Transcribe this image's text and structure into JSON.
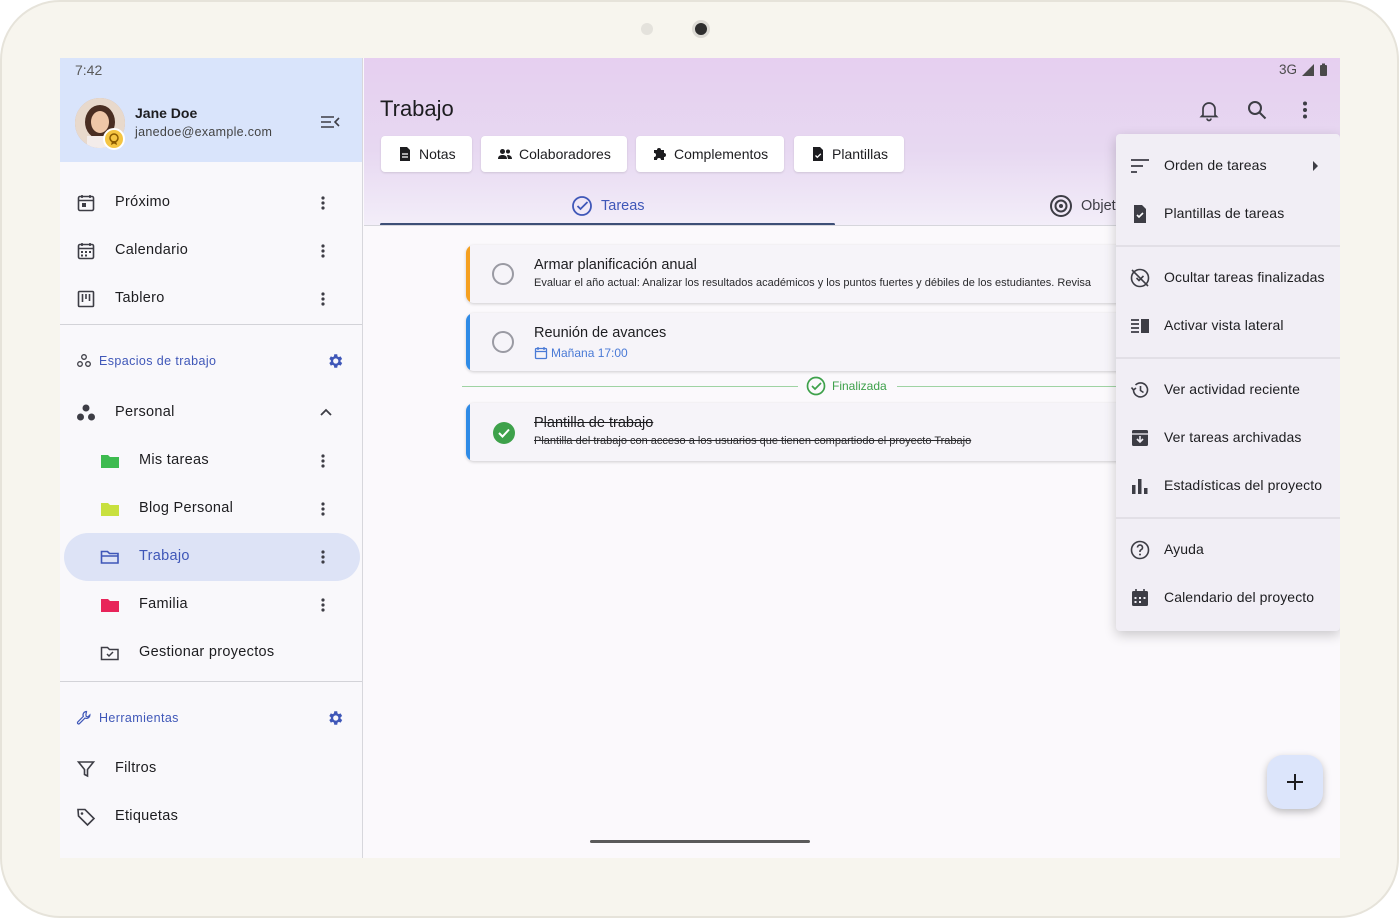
{
  "status": {
    "time": "7:42",
    "network": "3G"
  },
  "user": {
    "name": "Jane Doe",
    "email": "janedoe@example.com"
  },
  "nav": {
    "main_items": [
      {
        "label": "Próximo",
        "icon": "calendar-today-icon"
      },
      {
        "label": "Calendario",
        "icon": "calendar-month-icon"
      },
      {
        "label": "Tablero",
        "icon": "board-icon"
      }
    ],
    "workspaces_header": "Espacios de trabajo",
    "workspace": {
      "label": "Personal"
    },
    "projects": [
      {
        "label": "Mis tareas",
        "color": "#3dbb4f"
      },
      {
        "label": "Blog Personal",
        "color": "#c8e03e"
      },
      {
        "label": "Trabajo",
        "color": "#3f57b8"
      },
      {
        "label": "Familia",
        "color": "#e8245a"
      },
      {
        "label": "Gestionar proyectos"
      }
    ],
    "tools_header": "Herramientas",
    "tools": [
      {
        "label": "Filtros",
        "icon": "filter-icon"
      },
      {
        "label": "Etiquetas",
        "icon": "tag-icon"
      }
    ]
  },
  "main": {
    "title": "Trabajo",
    "chips": [
      {
        "label": "Notas",
        "icon": "note-icon"
      },
      {
        "label": "Colaboradores",
        "icon": "people-icon"
      },
      {
        "label": "Complementos",
        "icon": "puzzle-icon"
      },
      {
        "label": "Plantillas",
        "icon": "template-icon"
      }
    ],
    "tabs": [
      {
        "label": "Tareas",
        "active": true
      },
      {
        "label": "Objet"
      }
    ],
    "tasks": [
      {
        "title": "Armar planificación anual",
        "description": "Evaluar el año actual: Analizar los resultados académicos y los puntos fuertes y débiles de los estudiantes. Revisa",
        "color": "#f5a020",
        "done": false
      },
      {
        "title": "Reunión de avances",
        "due": "Mañana 17:00",
        "color": "#2f8be6",
        "done": false
      }
    ],
    "finished_label": "Finalizada",
    "done_tasks": [
      {
        "title": "Plantilla de trabajo",
        "description": "Plantilla del trabajo con acceso a los usuarios que tienen compartiodo el proyecto Trabajo",
        "color": "#2f8be6",
        "done": true
      }
    ]
  },
  "menu": {
    "items": [
      {
        "label": "Orden de tareas",
        "icon": "sort-icon",
        "submenu": true
      },
      {
        "label": "Plantillas de tareas",
        "icon": "task-template-icon"
      },
      {
        "label": "Ocultar tareas finalizadas",
        "icon": "hide-done-icon"
      },
      {
        "label": "Activar vista lateral",
        "icon": "side-view-icon"
      },
      {
        "label": "Ver actividad reciente",
        "icon": "history-icon"
      },
      {
        "label": "Ver tareas archivadas",
        "icon": "archive-icon"
      },
      {
        "label": "Estadísticas del proyecto",
        "icon": "stats-icon"
      },
      {
        "label": "Ayuda",
        "icon": "help-icon"
      },
      {
        "label": "Calendario del proyecto",
        "icon": "project-calendar-icon"
      }
    ]
  },
  "colors": {
    "accent": "#3f57b8",
    "success": "#3ea14b"
  }
}
